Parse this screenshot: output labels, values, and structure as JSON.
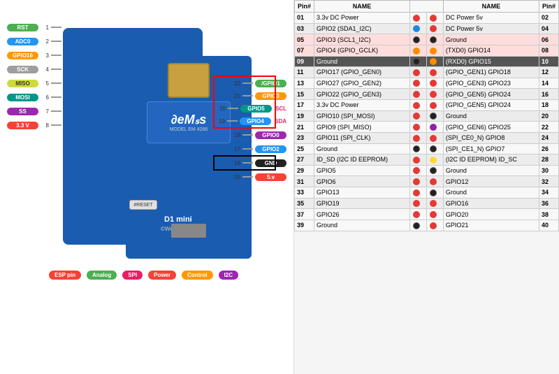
{
  "left": {
    "board": {
      "brand": "∂eMₛs",
      "model": "MODEL EM 4266",
      "d1label": "D1 mini",
      "wemos": "©Wemos.cc",
      "reset": "#RESET"
    },
    "pins_left": [
      {
        "num": "1",
        "label": "RST",
        "color": "c-green"
      },
      {
        "num": "2",
        "label": "ADC0",
        "color": "c-blue"
      },
      {
        "num": "3",
        "label": "GPIO16",
        "color": "c-orange"
      },
      {
        "num": "4",
        "label": "SCK",
        "color": "c-gray"
      },
      {
        "num": "5",
        "label": "MISO",
        "color": "c-yellow"
      },
      {
        "num": "6",
        "label": "MOSI",
        "color": "c-teal"
      },
      {
        "num": "7",
        "label": "SS",
        "color": "c-purple"
      },
      {
        "num": "8",
        "label": "3.3V",
        "color": "c-red"
      }
    ],
    "pins_right": [
      {
        "num": "22",
        "label": "/GPIO1"
      },
      {
        "num": "21",
        "label": "GPIO3"
      },
      {
        "num": "20",
        "label": "GPIO5",
        "highlight": "scl"
      },
      {
        "num": "19",
        "label": "GPIO4",
        "highlight": "sda"
      },
      {
        "num": "18",
        "label": "GPIO0"
      },
      {
        "num": "17",
        "label": "GPIO2"
      },
      {
        "num": "16",
        "label": "GND",
        "black": true
      },
      {
        "num": "15",
        "label": "5.v"
      }
    ],
    "scl_label": "SCL",
    "sda_label": "SDA",
    "legend": [
      {
        "label": "ESP pin",
        "color": "#f44336"
      },
      {
        "label": "Analog",
        "color": "#4caf50"
      },
      {
        "label": "SPI",
        "color": "#e91e63"
      },
      {
        "label": "Power",
        "color": "#f44336"
      },
      {
        "label": "Control",
        "color": "#ff9800"
      },
      {
        "label": "I2C",
        "color": "#9c27b0"
      }
    ]
  },
  "right": {
    "headers": [
      "Pin#",
      "NAME",
      "",
      "NAME",
      "Pin#"
    ],
    "rows": [
      {
        "pin_l": "01",
        "name_l": "3.3v DC Power",
        "dot_l": "red",
        "dot_r": "red",
        "name_r": "DC Power 5v",
        "pin_r": "02",
        "highlight": ""
      },
      {
        "pin_l": "03",
        "name_l": "GPIO2 (SDA1_I2C)",
        "dot_l": "blue",
        "dot_r": "red",
        "name_r": "DC Power 5v",
        "pin_r": "04",
        "highlight": ""
      },
      {
        "pin_l": "05",
        "name_l": "GPIO3 (SCL1_I2C)",
        "dot_l": "black",
        "dot_r": "black",
        "name_r": "Ground",
        "pin_r": "06",
        "highlight": "red"
      },
      {
        "pin_l": "07",
        "name_l": "GPIO4 (GPIO_GCLK)",
        "dot_l": "orange",
        "dot_r": "orange",
        "name_r": "(TXD0) GPIO14",
        "pin_r": "08",
        "highlight": "red"
      },
      {
        "pin_l": "09",
        "name_l": "Ground",
        "dot_l": "black",
        "dot_r": "orange",
        "name_r": "(RXD0) GPIO15",
        "pin_r": "10",
        "highlight": "red"
      },
      {
        "pin_l": "11",
        "name_l": "GPIO17 (GPIO_GEN0)",
        "dot_l": "red",
        "dot_r": "red",
        "name_r": "(GPIO_GEN1) GPIO18",
        "pin_r": "12",
        "highlight": ""
      },
      {
        "pin_l": "13",
        "name_l": "GPIO27 (GPIO_GEN2)",
        "dot_l": "red",
        "dot_r": "red",
        "name_r": "(GPIO_GEN3) GPIO23",
        "pin_r": "14",
        "highlight": ""
      },
      {
        "pin_l": "15",
        "name_l": "GPIO22 (GPIO_GEN3)",
        "dot_l": "red",
        "dot_r": "red",
        "name_r": "(GPIO_GEN5) GPIO24",
        "pin_r": "16",
        "highlight": ""
      },
      {
        "pin_l": "17",
        "name_l": "3.3v DC Power",
        "dot_l": "red",
        "dot_r": "red",
        "name_r": "(GPIO_GEN5) GPIO24",
        "pin_r": "18",
        "highlight": ""
      },
      {
        "pin_l": "19",
        "name_l": "GPIO10 (SPI_MOSI)",
        "dot_l": "red",
        "dot_r": "black",
        "name_r": "Ground",
        "pin_r": "20",
        "highlight": ""
      },
      {
        "pin_l": "21",
        "name_l": "GPIO9 (SPI_MISO)",
        "dot_l": "red",
        "dot_r": "purple",
        "name_r": "(GPIO_GEN6) GPIO25",
        "pin_r": "22",
        "highlight": ""
      },
      {
        "pin_l": "23",
        "name_l": "GPIO11 (SPI_CLK)",
        "dot_l": "red",
        "dot_r": "red",
        "name_r": "(SPI_CE0_N) GPIO8",
        "pin_r": "24",
        "highlight": ""
      },
      {
        "pin_l": "25",
        "name_l": "Ground",
        "dot_l": "black",
        "dot_r": "black",
        "name_r": "(SPI_CE1_N) GPIO7",
        "pin_r": "26",
        "highlight": ""
      },
      {
        "pin_l": "27",
        "name_l": "ID_SD (I2C ID EEPROM)",
        "dot_l": "red",
        "dot_r": "yellow",
        "name_r": "(I2C ID EEPROM) ID_SC",
        "pin_r": "28",
        "highlight": ""
      },
      {
        "pin_l": "29",
        "name_l": "GPIO5",
        "dot_l": "red",
        "dot_r": "black",
        "name_r": "Ground",
        "pin_r": "30",
        "highlight": ""
      },
      {
        "pin_l": "31",
        "name_l": "GPIO6",
        "dot_l": "red",
        "dot_r": "red",
        "name_r": "GPIO12",
        "pin_r": "32",
        "highlight": ""
      },
      {
        "pin_l": "33",
        "name_l": "GPIO13",
        "dot_l": "red",
        "dot_r": "black",
        "name_r": "Ground",
        "pin_r": "34",
        "highlight": ""
      },
      {
        "pin_l": "35",
        "name_l": "GPIO19",
        "dot_l": "red",
        "dot_r": "red",
        "name_r": "GPIO16",
        "pin_r": "36",
        "highlight": ""
      },
      {
        "pin_l": "37",
        "name_l": "GPIO26",
        "dot_l": "red",
        "dot_r": "red",
        "name_r": "GPIO20",
        "pin_r": "38",
        "highlight": ""
      },
      {
        "pin_l": "39",
        "name_l": "Ground",
        "dot_l": "black",
        "dot_r": "red",
        "name_r": "GPIO21",
        "pin_r": "40",
        "highlight": "ground-bottom"
      }
    ]
  }
}
